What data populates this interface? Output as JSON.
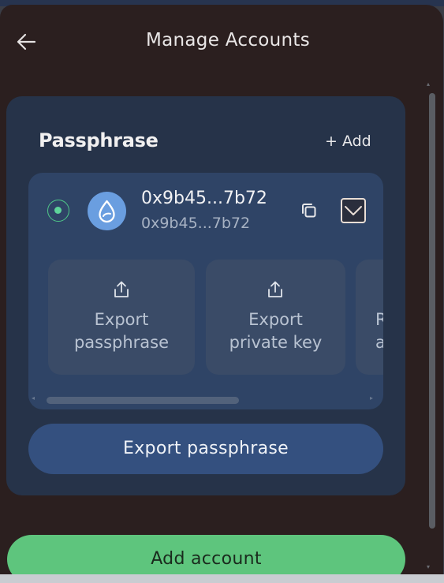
{
  "header": {
    "title": "Manage Accounts"
  },
  "section": {
    "title": "Passphrase",
    "add_label": "+ Add"
  },
  "account": {
    "address": "0x9b45...7b72",
    "address_secondary": "0x9b45...7b72",
    "selected": true
  },
  "actions": [
    {
      "label": "Export\npassphrase",
      "icon": "share-icon"
    },
    {
      "label": "Export\nprivate key",
      "icon": "share-icon"
    },
    {
      "label": "R\na",
      "icon": "share-icon"
    }
  ],
  "buttons": {
    "export_passphrase": "Export passphrase",
    "add_account": "Add account"
  },
  "colors": {
    "panel_bg": "#2b1f1f",
    "card_bg": "#263349",
    "account_bg": "#2f4466",
    "primary_button": "#34507f",
    "success_button": "#5ec57d",
    "selected_radio": "#5ed49a",
    "avatar_bg": "#6a9ee0"
  }
}
